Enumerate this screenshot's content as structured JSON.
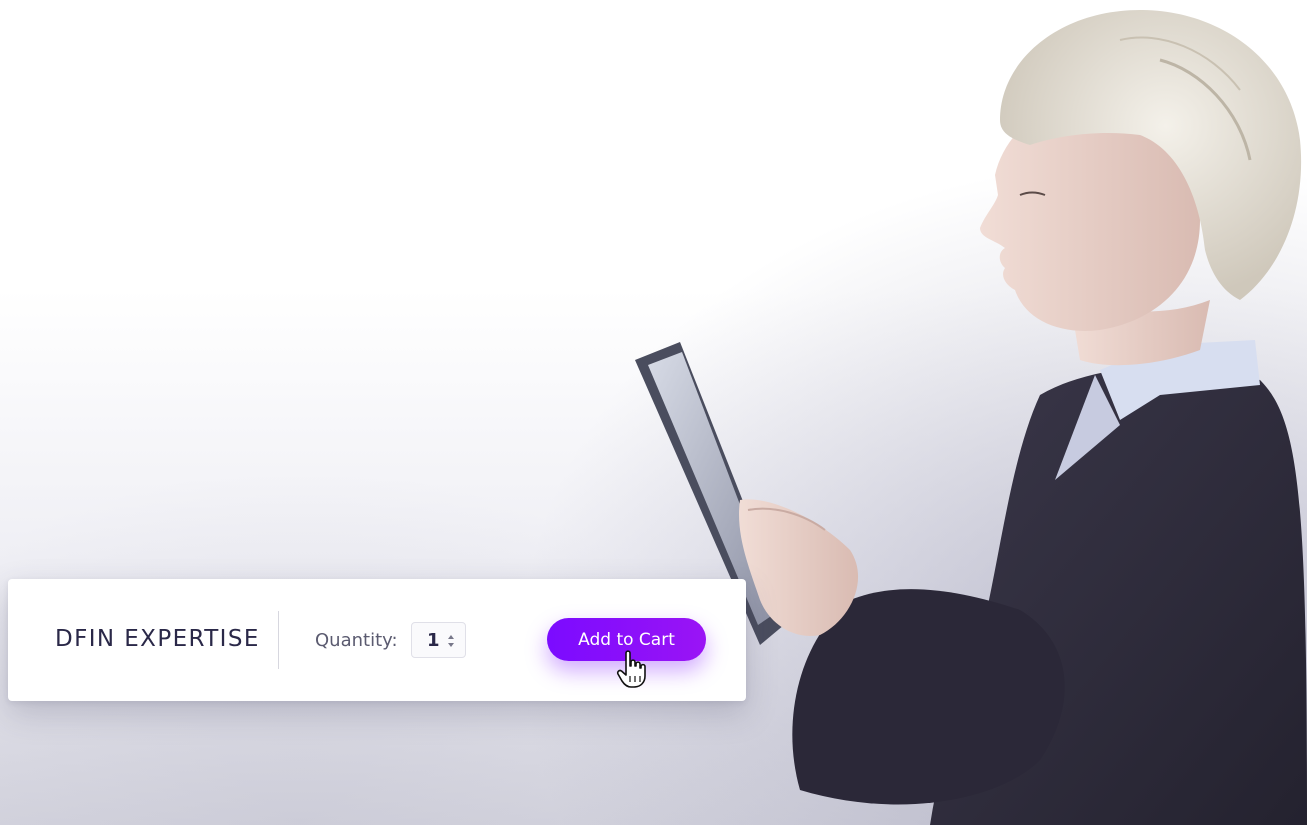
{
  "product": {
    "title": "DFIN EXPERTISE"
  },
  "quantity": {
    "label": "Quantity:",
    "value": "1"
  },
  "cart_button": {
    "label": "Add to Cart"
  },
  "colors": {
    "accent": "#7b0bff",
    "brand_text": "#2a2848",
    "muted_text": "#5b5b70",
    "suit": "#2f2c3d",
    "hair": "#e9e4d8"
  },
  "icons": {
    "stepper": "up-down-arrows-icon",
    "cursor": "hand-pointer-icon"
  }
}
